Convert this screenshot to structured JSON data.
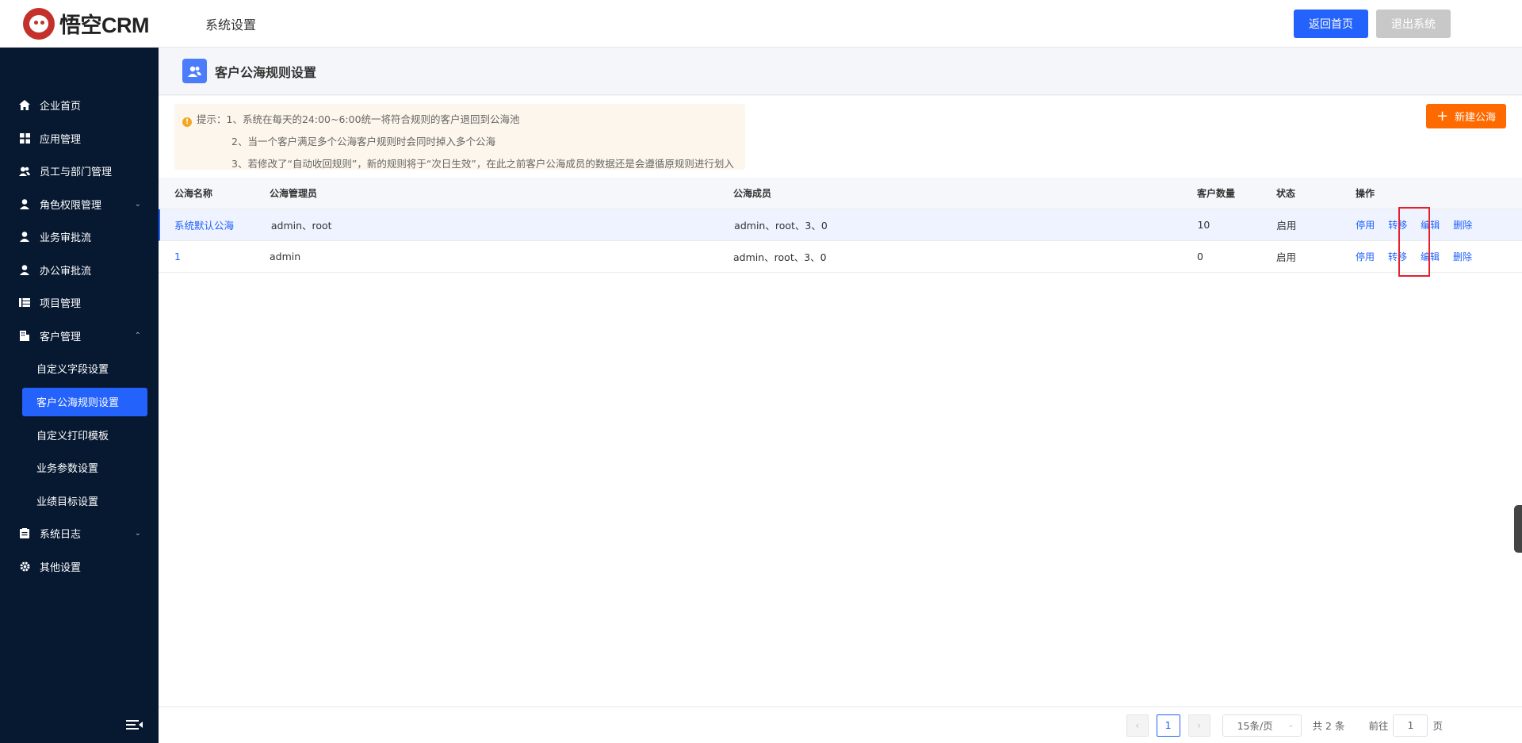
{
  "app": {
    "logo_text": "悟空CRM",
    "section_title": "系统设置"
  },
  "header": {
    "home_button": "返回首页",
    "logout_button": "退出系统"
  },
  "sidebar": {
    "items": [
      {
        "label": "企业首页",
        "icon": "home-icon"
      },
      {
        "label": "应用管理",
        "icon": "grid-icon"
      },
      {
        "label": "员工与部门管理",
        "icon": "users-icon"
      },
      {
        "label": "角色权限管理",
        "icon": "user-icon",
        "arrow": "⌄"
      },
      {
        "label": "业务审批流",
        "icon": "user-check-icon"
      },
      {
        "label": "办公审批流",
        "icon": "user-check-icon"
      },
      {
        "label": "项目管理",
        "icon": "list-icon"
      },
      {
        "label": "客户管理",
        "icon": "building-icon",
        "arrow": "⌃"
      }
    ],
    "sub_items": [
      "自定义字段设置",
      "客户公海规则设置",
      "自定义打印模板",
      "业务参数设置",
      "业绩目标设置"
    ],
    "items_after": [
      {
        "label": "系统日志",
        "icon": "log-icon",
        "arrow": "⌄"
      },
      {
        "label": "其他设置",
        "icon": "gear-icon"
      }
    ]
  },
  "page": {
    "title": "客户公海规则设置",
    "tip": {
      "line1": "提示：1、系统在每天的24:00~6:00统一将符合规则的客户退回到公海池",
      "line2": "2、当一个客户满足多个公海客户规则时会同时掉入多个公海",
      "line3": "3、若修改了“自动收回规则”，新的规则将于“次日生效”，在此之前客户公海成员的数据还是会遵循原规则进行划入"
    },
    "new_button": "新建公海"
  },
  "table": {
    "headers": [
      "公海名称",
      "公海管理员",
      "公海成员",
      "客户数量",
      "状态",
      "操作"
    ],
    "rows": [
      {
        "name": "系统默认公海",
        "admins": "admin、root",
        "members": "admin、root、3、0",
        "count": "10",
        "status": "启用"
      },
      {
        "name": "1",
        "admins": "admin",
        "members": "admin、root、3、0",
        "count": "0",
        "status": "启用"
      }
    ],
    "actions": [
      "停用",
      "转移",
      "编辑",
      "删除"
    ]
  },
  "pagination": {
    "current_page": "1",
    "page_size": "15条/页",
    "total": "共 2 条",
    "goto_prefix": "前往",
    "goto_value": "1",
    "goto_suffix": "页"
  }
}
